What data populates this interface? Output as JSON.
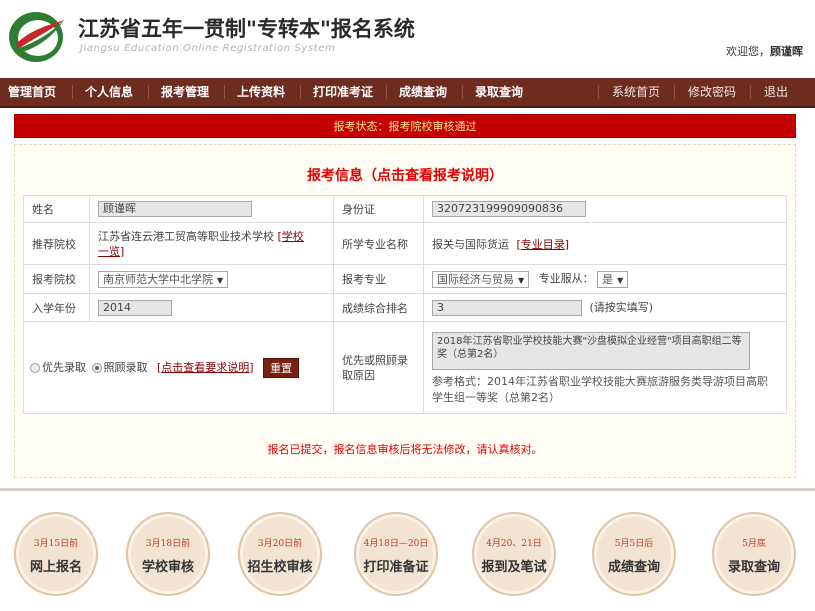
{
  "header": {
    "title_cn": "江苏省五年一贯制\"专转本\"报名系统",
    "title_en": "Jiangsu Education Online Registration System",
    "welcome_prefix": "欢迎您，",
    "user_name": "顾谨晖"
  },
  "nav": {
    "left": [
      "管理首页",
      "个人信息",
      "报考管理",
      "上传资料",
      "打印准考证",
      "成绩查询",
      "录取查询"
    ],
    "right": [
      "系统首页",
      "修改密码",
      "退出"
    ]
  },
  "status": "报考状态：报考院校审核通过",
  "panel": {
    "title": "报考信息（点击查看报考说明）",
    "name_label": "姓名",
    "name_value": "顾谨晖",
    "id_label": "身份证",
    "id_value": "320723199909090836",
    "rec_school_label": "推荐院校",
    "rec_school_value": "江苏省连云港工贸高等职业技术学校",
    "rec_school_link_a": "学校",
    "rec_school_link_b": "一览",
    "major_label": "所学专业名称",
    "major_value": "报关与国际货运",
    "major_link": "专业目录",
    "apply_school_label": "报考院校",
    "apply_school_value": "南京师范大学中北学院",
    "apply_major_label": "报考专业",
    "apply_major_value": "国际经济与贸易",
    "obey_label": "专业服从：",
    "obey_value": "是",
    "year_label": "入学年份",
    "year_value": "2014",
    "rank_label": "成绩综合排名",
    "rank_value": "3",
    "rank_hint": "(请按实填写)",
    "priority_option": "优先录取",
    "care_option": "照顾录取",
    "view_req_link": "点击查看要求说明",
    "reset_label": "重置",
    "reason_label": "优先或照顾录取原因",
    "reason_value": "2018年江苏省职业学校技能大赛\"沙盘模拟企业经营\"项目高职组二等奖（总第2名）",
    "reference": "参考格式：2014年江苏省职业学校技能大赛旅游服务类导游项目高职学生组一等奖（总第2名）",
    "notice": "报名已提交，报名信息审核后将无法修改，请认真核对。"
  },
  "timeline": [
    {
      "date": "3月15日前",
      "label": "网上报名"
    },
    {
      "date": "3月18日前",
      "label": "学校审核"
    },
    {
      "date": "3月20日前",
      "label": "招生校审核"
    },
    {
      "date": "4月18日—20日",
      "label": "打印准备证"
    },
    {
      "date": "4月20、21日",
      "label": "报到及笔试"
    },
    {
      "date": "5月5日后",
      "label": "成绩查询"
    },
    {
      "date": "5月底",
      "label": "录取查询"
    }
  ],
  "colors": {
    "nav_bg": "#6e2b1f",
    "status_bg": "#c40000",
    "accent_red": "#e60000",
    "circle_bg": "#f3e3d2"
  },
  "icons": {
    "logo": "swoosh-logo-icon"
  }
}
